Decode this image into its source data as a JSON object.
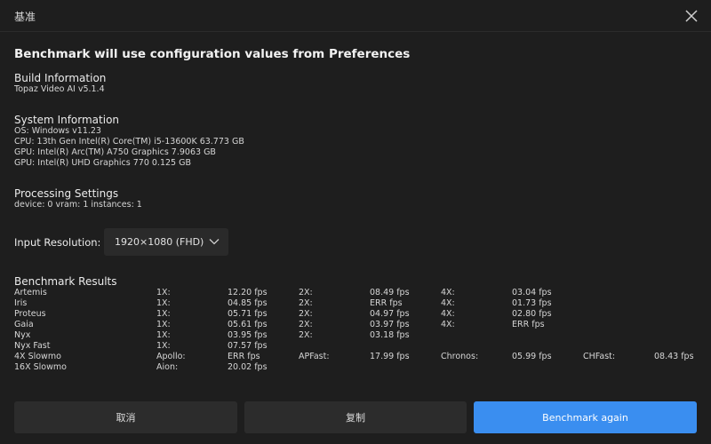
{
  "window": {
    "title": "基准"
  },
  "headline": "Benchmark will use configuration values from Preferences",
  "build": {
    "title": "Build Information",
    "lines": [
      "Topaz Video AI  v5.1.4"
    ]
  },
  "system": {
    "title": "System Information",
    "lines": [
      "OS: Windows v11.23",
      "CPU: 13th Gen Intel(R) Core(TM) i5-13600K   63.773 GB",
      "GPU: Intel(R) Arc(TM) A750 Graphics   7.9063 GB",
      "GPU: Intel(R) UHD Graphics 770   0.125 GB"
    ]
  },
  "processing": {
    "title": "Processing Settings",
    "lines": [
      "device: 0 vram: 1 instances: 1"
    ]
  },
  "input_resolution": {
    "label": "Input Resolution:",
    "value": "1920×1080 (FHD)"
  },
  "results": {
    "title": "Benchmark Results",
    "rows": [
      [
        "Artemis",
        "1X:",
        "12.20 fps",
        "2X:",
        "08.49 fps",
        "4X:",
        "03.04 fps",
        "",
        ""
      ],
      [
        "Iris",
        "1X:",
        "04.85 fps",
        "2X:",
        "ERR fps",
        "4X:",
        "01.73 fps",
        "",
        ""
      ],
      [
        "Proteus",
        "1X:",
        "05.71 fps",
        "2X:",
        "04.97 fps",
        "4X:",
        "02.80 fps",
        "",
        ""
      ],
      [
        "Gaia",
        "1X:",
        "05.61 fps",
        "2X:",
        "03.97 fps",
        "4X:",
        "ERR fps",
        "",
        ""
      ],
      [
        "Nyx",
        "1X:",
        "03.95 fps",
        "2X:",
        "03.18 fps",
        "",
        "",
        "",
        ""
      ],
      [
        "Nyx Fast",
        "1X:",
        "07.57 fps",
        "",
        "",
        "",
        "",
        "",
        ""
      ],
      [
        "4X Slowmo",
        "Apollo:",
        "ERR fps",
        "APFast:",
        "17.99 fps",
        "Chronos:",
        "05.99 fps",
        "CHFast:",
        "08.43 fps"
      ],
      [
        "16X Slowmo",
        "Aion:",
        "20.02 fps",
        "",
        "",
        "",
        "",
        "",
        ""
      ]
    ]
  },
  "buttons": {
    "cancel": "取消",
    "copy": "复制",
    "again": "Benchmark again"
  },
  "colors": {
    "primary": "#3a8ef0",
    "background": "#1e1e1e",
    "surface": "#2c2c2c"
  },
  "icons": {
    "close": "close-icon",
    "dropdown": "chevron-down-icon"
  }
}
